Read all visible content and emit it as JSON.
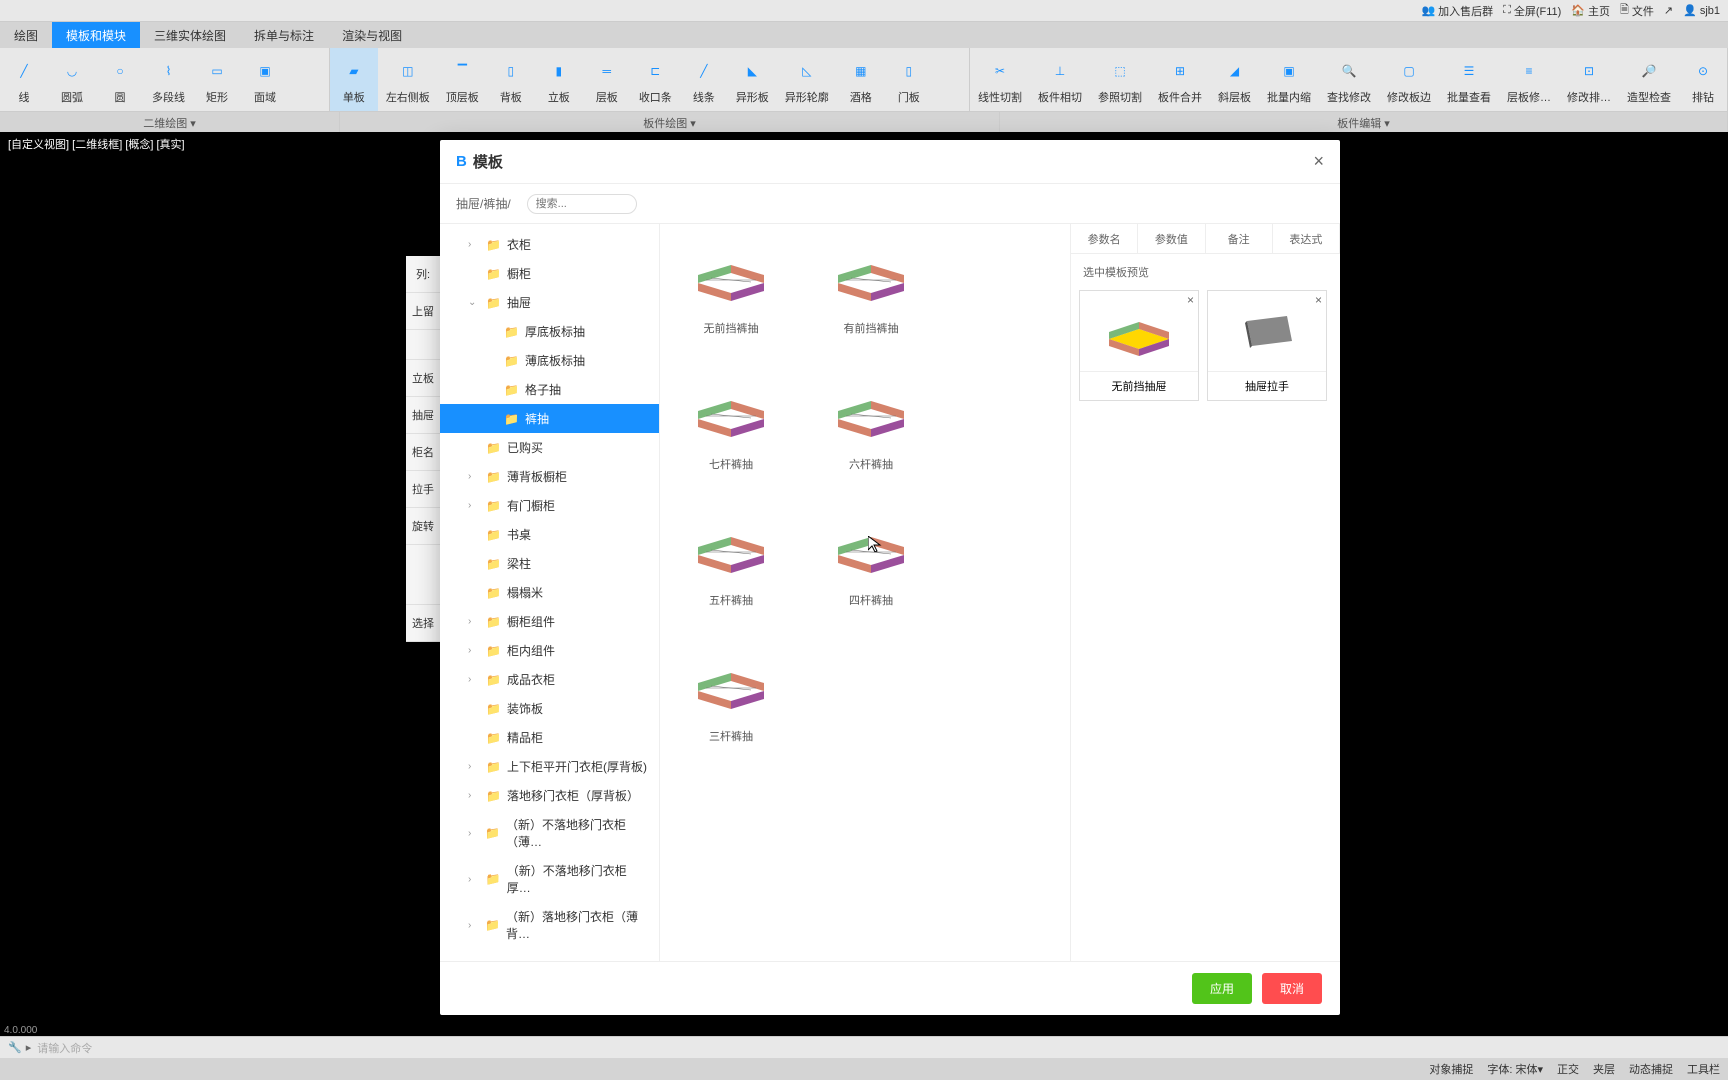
{
  "topbar": {
    "aftersales": "加入售后群",
    "fullscreen": "全屏(F11)",
    "home": "主页",
    "file": "文件",
    "share": "",
    "user": "sjb1"
  },
  "ribbon_tabs": [
    "绘图",
    "模板和模块",
    "三维实体绘图",
    "拆单与标注",
    "渲染与视图"
  ],
  "ribbon_buttons_2d": [
    {
      "label": "线"
    },
    {
      "label": "圆弧"
    },
    {
      "label": "圆"
    },
    {
      "label": "多段线"
    },
    {
      "label": "矩形"
    },
    {
      "label": "面域"
    }
  ],
  "ribbon_buttons_panel": [
    {
      "label": "单板"
    },
    {
      "label": "左右侧板"
    },
    {
      "label": "顶层板"
    },
    {
      "label": "背板"
    },
    {
      "label": "立板"
    },
    {
      "label": "层板"
    },
    {
      "label": "收口条"
    },
    {
      "label": "线条"
    },
    {
      "label": "异形板"
    },
    {
      "label": "异形轮廓"
    },
    {
      "label": "酒格"
    },
    {
      "label": "门板"
    }
  ],
  "ribbon_buttons_edit": [
    {
      "label": "线性切割"
    },
    {
      "label": "板件相切"
    },
    {
      "label": "参照切割"
    },
    {
      "label": "板件合并"
    },
    {
      "label": "斜层板"
    },
    {
      "label": "批量内缩"
    },
    {
      "label": "查找修改"
    },
    {
      "label": "修改板边"
    },
    {
      "label": "批量查看"
    },
    {
      "label": "层板修…"
    },
    {
      "label": "修改排…"
    },
    {
      "label": "造型检查"
    },
    {
      "label": "排钻"
    }
  ],
  "ribbon_footer": {
    "g1": "二维绘图 ▾",
    "g2": "板件绘图 ▾",
    "g3": "板件编辑 ▾"
  },
  "viewport_status": "[自定义视图] [二维线框] [概念] [真实]",
  "side_labels": {
    "col": "列:",
    "top": "上留",
    "vert": "立板",
    "drawer": "抽屉",
    "cab_name": "柜名",
    "handle": "拉手",
    "rotate": "旋转",
    "select": "选择"
  },
  "modal": {
    "title": "模板",
    "breadcrumb": "抽屉/裤抽/",
    "search_placeholder": "搜索...",
    "close": "×"
  },
  "tree": [
    {
      "label": "衣柜",
      "indent": 1,
      "chevron": "›"
    },
    {
      "label": "橱柜",
      "indent": 1,
      "chevron": ""
    },
    {
      "label": "抽屉",
      "indent": 1,
      "chevron": "⌄",
      "open": true
    },
    {
      "label": "厚底板标抽",
      "indent": 2
    },
    {
      "label": "薄底板标抽",
      "indent": 2
    },
    {
      "label": "格子抽",
      "indent": 2
    },
    {
      "label": "裤抽",
      "indent": 2,
      "selected": true
    },
    {
      "label": "已购买",
      "indent": 1
    },
    {
      "label": "薄背板橱柜",
      "indent": 1,
      "chevron": "›"
    },
    {
      "label": "有门橱柜",
      "indent": 1,
      "chevron": "›"
    },
    {
      "label": "书桌",
      "indent": 1
    },
    {
      "label": "梁柱",
      "indent": 1
    },
    {
      "label": "榻榻米",
      "indent": 1
    },
    {
      "label": "橱柜组件",
      "indent": 1,
      "chevron": "›"
    },
    {
      "label": "柜内组件",
      "indent": 1,
      "chevron": "›"
    },
    {
      "label": "成品衣柜",
      "indent": 1,
      "chevron": "›"
    },
    {
      "label": "装饰板",
      "indent": 1
    },
    {
      "label": "精品柜",
      "indent": 1
    },
    {
      "label": "上下柜平开门衣柜(厚背板)",
      "indent": 1,
      "chevron": "›"
    },
    {
      "label": "落地移门衣柜（厚背板）",
      "indent": 1,
      "chevron": "›"
    },
    {
      "label": "（新）不落地移门衣柜（薄…",
      "indent": 1,
      "chevron": "›"
    },
    {
      "label": "（新）不落地移门衣柜厚…",
      "indent": 1,
      "chevron": "›"
    },
    {
      "label": "（新）落地移门衣柜（薄背…",
      "indent": 1,
      "chevron": "›"
    }
  ],
  "templates": [
    {
      "name": "无前挡裤抽"
    },
    {
      "name": "有前挡裤抽"
    },
    {
      "name": "七杆裤抽"
    },
    {
      "name": "六杆裤抽"
    },
    {
      "name": "五杆裤抽"
    },
    {
      "name": "四杆裤抽"
    },
    {
      "name": "三杆裤抽"
    }
  ],
  "preview": {
    "tabs": [
      "参数名",
      "参数值",
      "备注",
      "表达式"
    ],
    "label": "选中模板预览",
    "items": [
      {
        "name": "无前挡抽屉"
      },
      {
        "name": "抽屉拉手"
      }
    ]
  },
  "modal_footer": {
    "apply": "应用",
    "cancel": "取消"
  },
  "command_bar": {
    "prompt": "请输入命令"
  },
  "version": "4.0.000",
  "statusbar": {
    "items": [
      "对象捕捉",
      "字体: 宋体▾",
      "正交",
      "夹层",
      "动态捕捉",
      "工具栏"
    ]
  }
}
